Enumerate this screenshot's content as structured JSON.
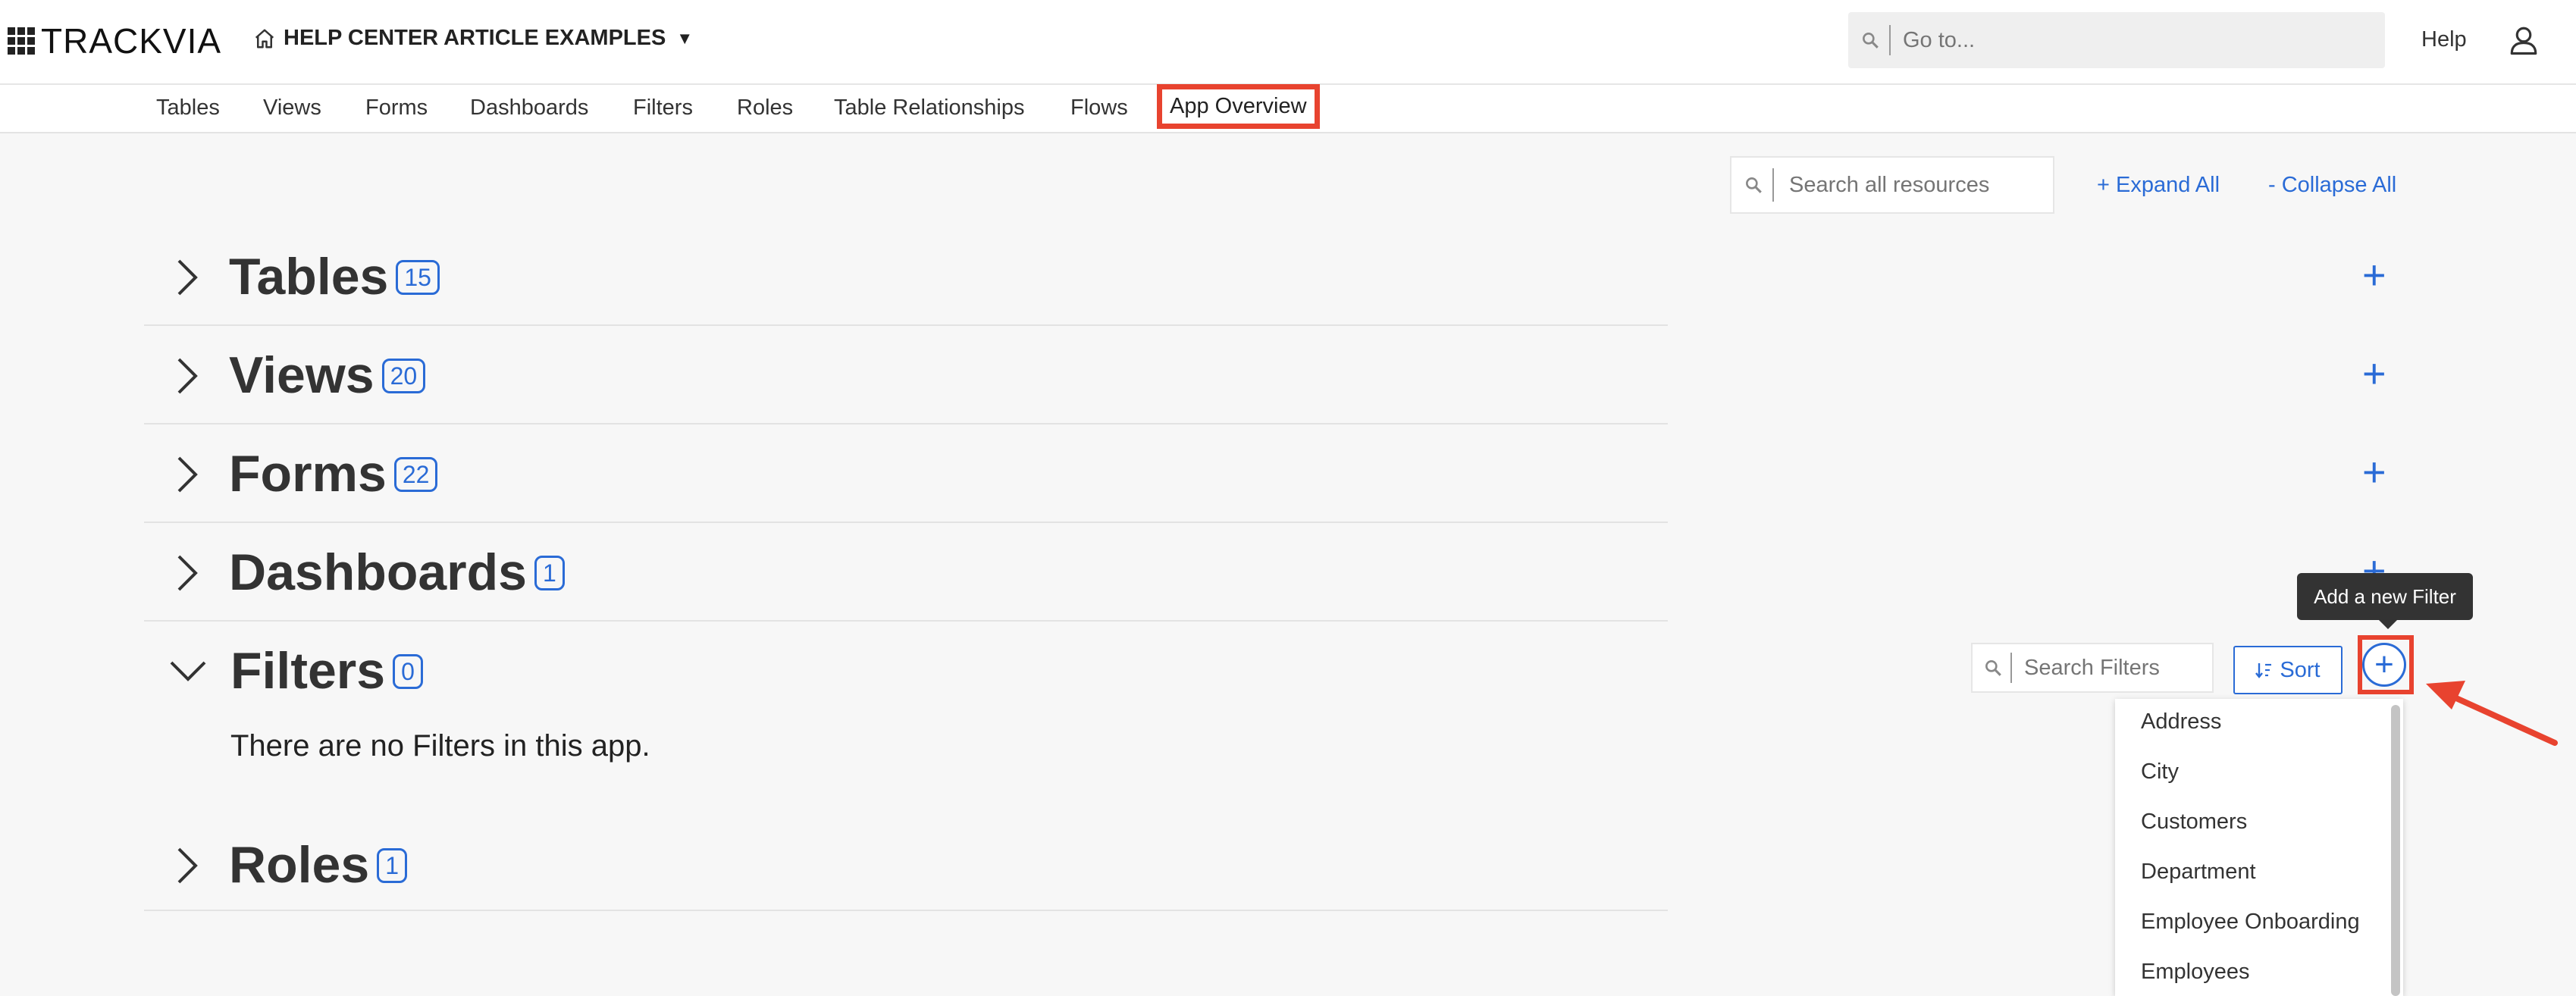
{
  "header": {
    "logo_text": "TRACKVIA",
    "app_name": "HELP CENTER ARTICLE EXAMPLES",
    "goto_placeholder": "Go to...",
    "help_label": "Help"
  },
  "nav": {
    "items": [
      "Tables",
      "Views",
      "Forms",
      "Dashboards",
      "Filters",
      "Roles",
      "Table Relationships",
      "Flows",
      "App Overview"
    ],
    "active": "App Overview"
  },
  "toolbar": {
    "search_placeholder": "Search all resources",
    "expand_all": "+ Expand All",
    "collapse_all": "- Collapse All"
  },
  "sections": [
    {
      "title": "Tables",
      "count": "15",
      "expanded": false
    },
    {
      "title": "Views",
      "count": "20",
      "expanded": false
    },
    {
      "title": "Forms",
      "count": "22",
      "expanded": false
    },
    {
      "title": "Dashboards",
      "count": "1",
      "expanded": false
    },
    {
      "title": "Filters",
      "count": "0",
      "expanded": true
    },
    {
      "title": "Roles",
      "count": "1",
      "expanded": false
    }
  ],
  "filters": {
    "empty_message": "There are no Filters in this app.",
    "search_placeholder": "Search Filters",
    "sort_label": "Sort",
    "add_tooltip": "Add a new Filter",
    "dropdown_items": [
      "Address",
      "City",
      "Customers",
      "Department",
      "Employee Onboarding",
      "Employees"
    ]
  },
  "colors": {
    "accent": "#2a6bd6",
    "highlight": "#e8432f",
    "background": "#f7f7f7"
  }
}
